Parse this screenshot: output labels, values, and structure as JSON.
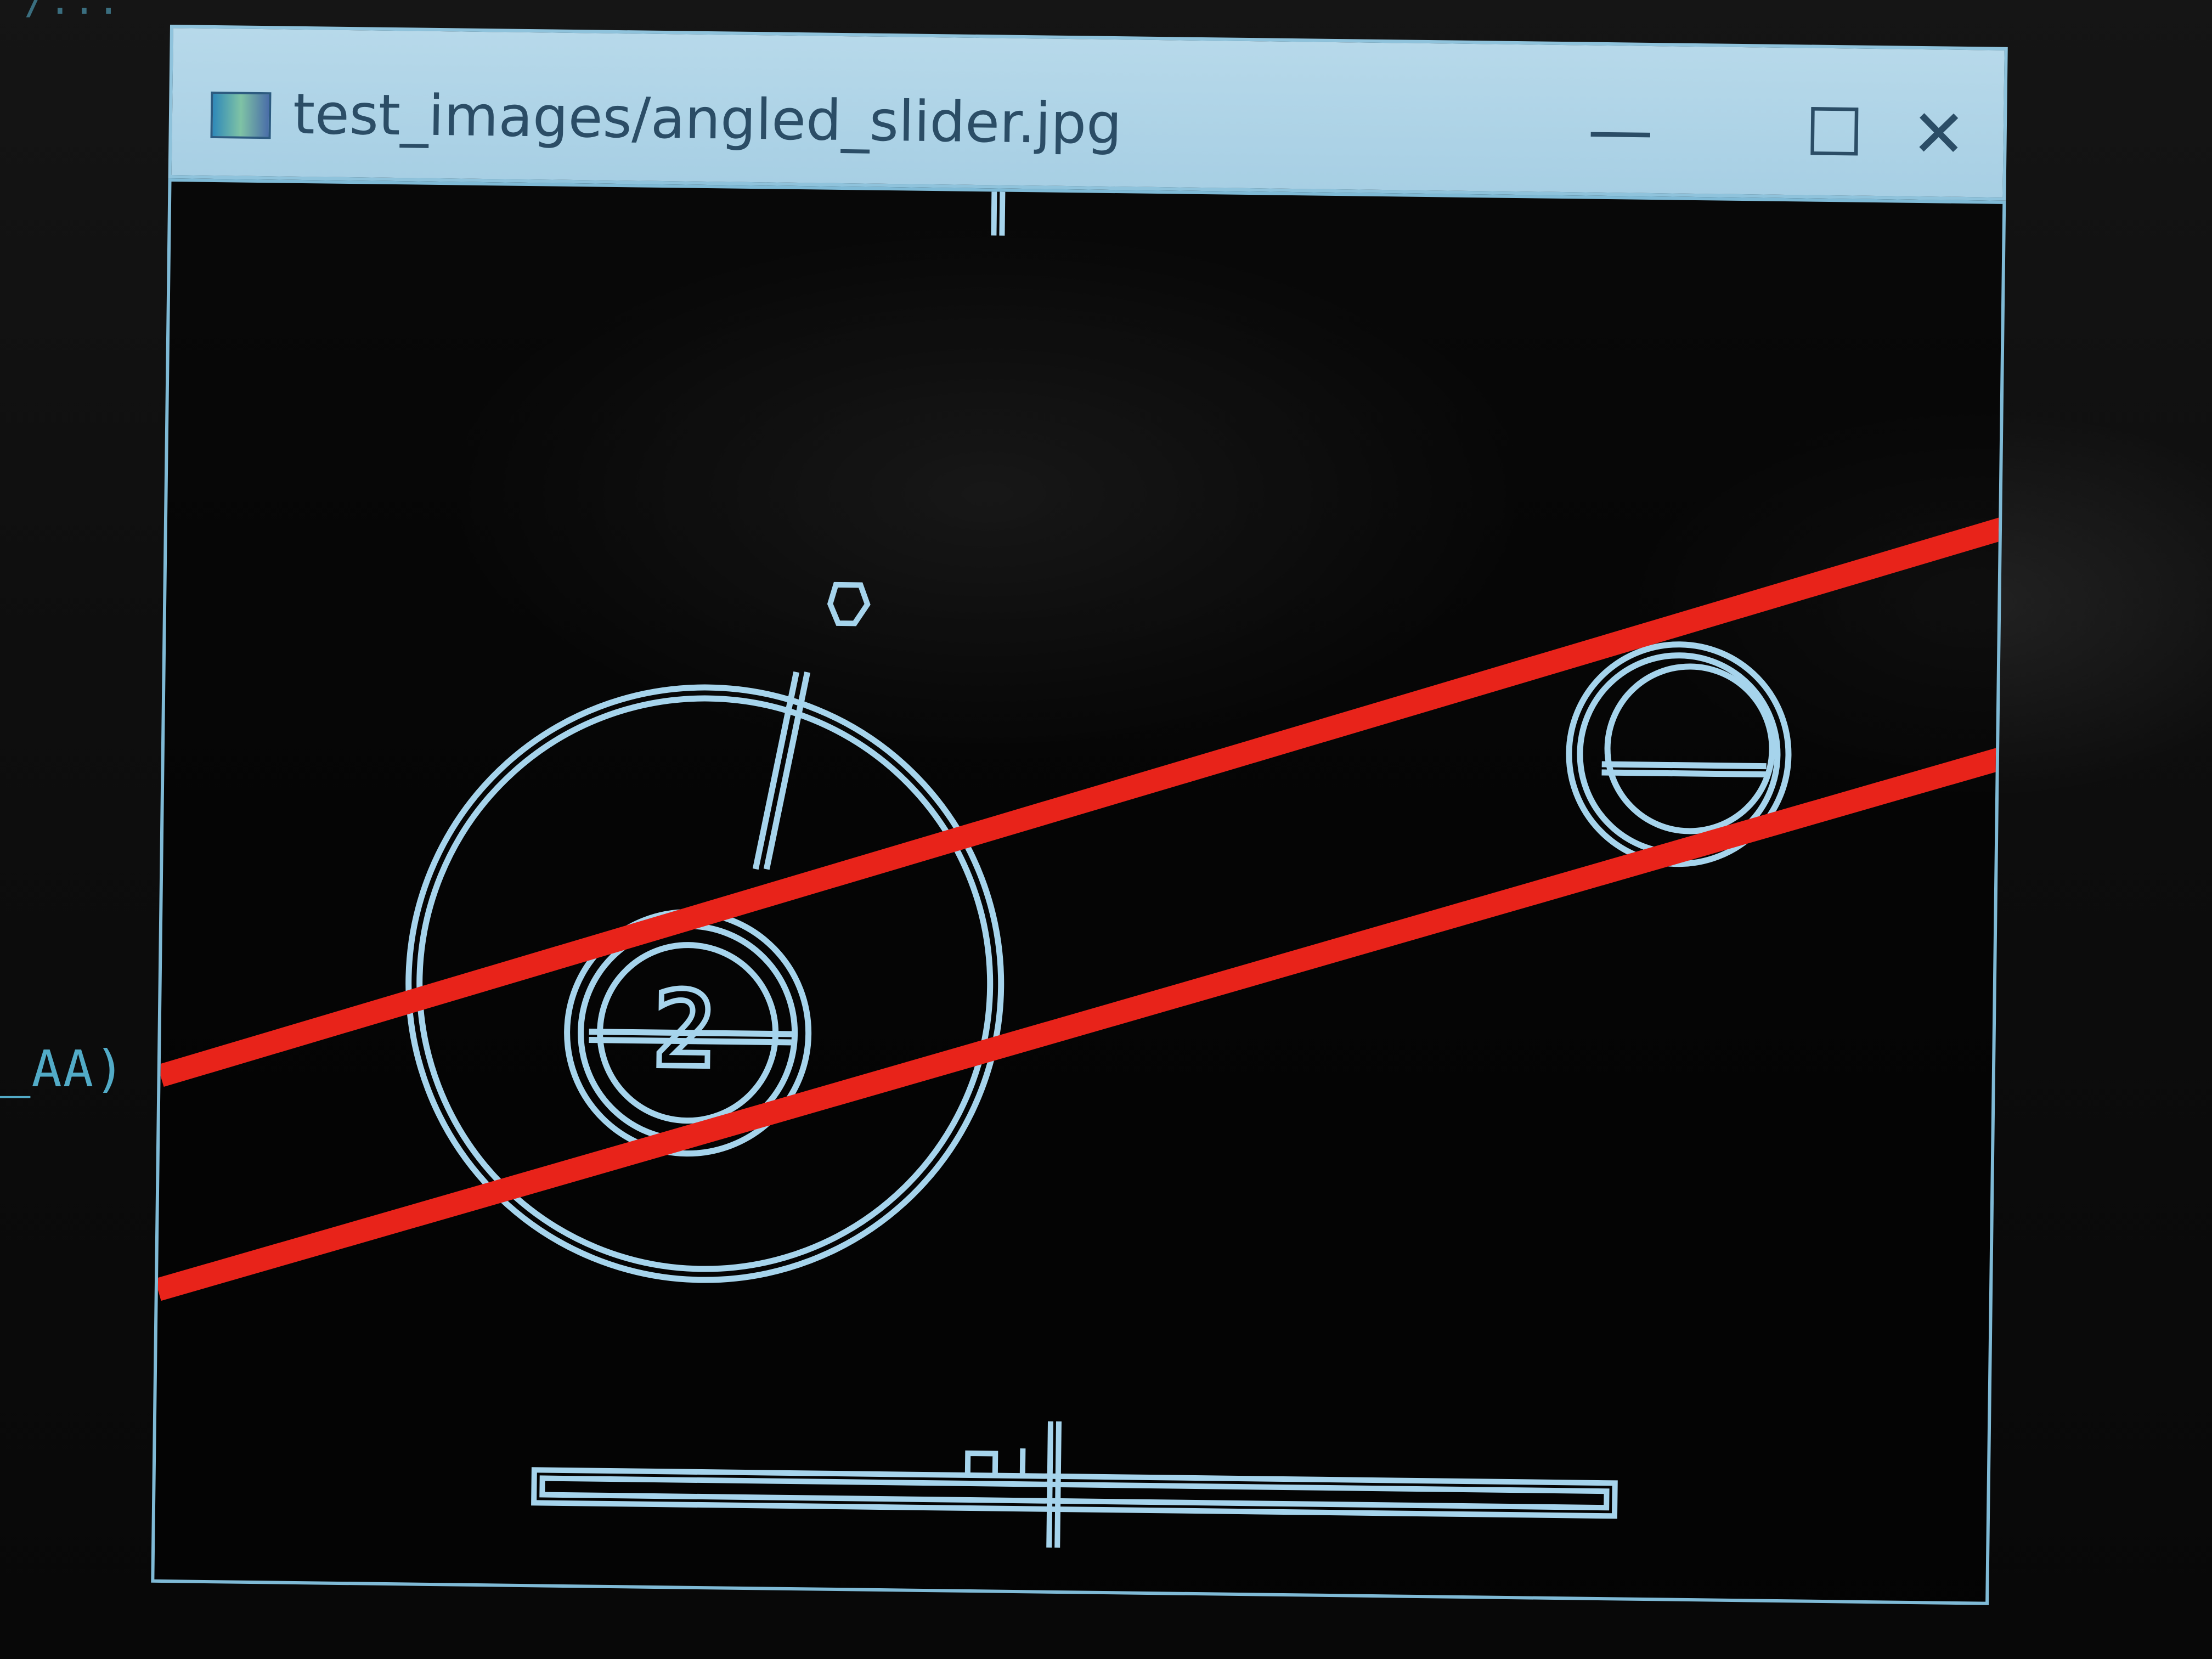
{
  "window": {
    "title": "test_images/angled_slider.jpg",
    "controls": {
      "minimize": "—",
      "maximize": "☐",
      "close": "✕"
    }
  },
  "background_terminal": {
    "visible_fragment": "_AA)",
    "top_fragment": "\"/..."
  },
  "canvas": {
    "background_color": "#000000",
    "line_color": "#e8231a",
    "shape_color": "#a6d4ec",
    "large_knob_label": "2",
    "icons": [
      "slider-knob-icon",
      "target-circle-icon",
      "horizontal-slider-track-icon"
    ]
  }
}
